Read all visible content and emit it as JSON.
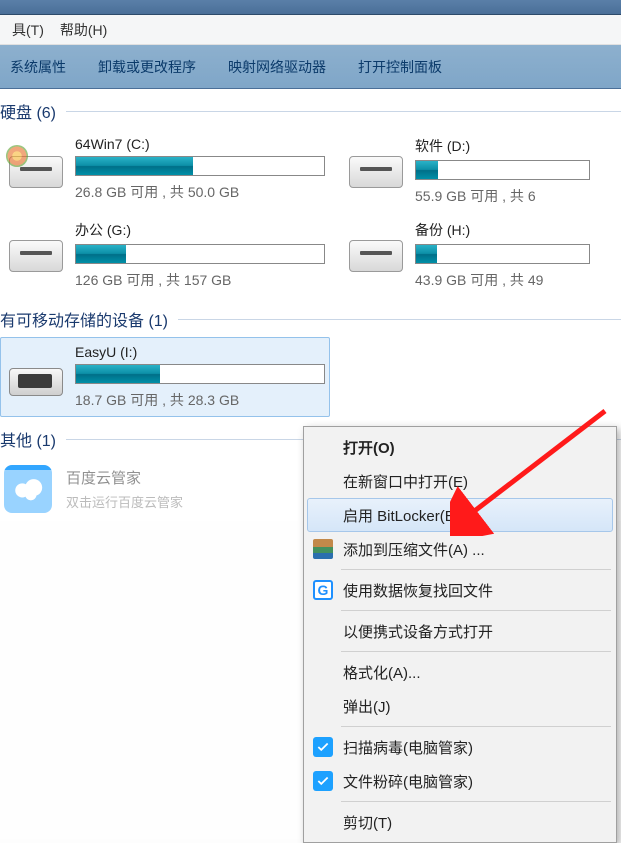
{
  "menubar": {
    "tools": "具(T)",
    "help": "帮助(H)"
  },
  "toolbar": {
    "sys_props": "系统属性",
    "uninstall": "卸载或更改程序",
    "map_drive": "映射网络驱动器",
    "ctrl_panel": "打开控制面板"
  },
  "sections": {
    "hdd": "硬盘 (6)",
    "removable": "有可移动存储的设备 (1)",
    "other": "其他 (1)"
  },
  "drives": {
    "c": {
      "name": "64Win7  (C:)",
      "stats": "26.8 GB 可用 , 共 50.0 GB",
      "pct": 47
    },
    "d": {
      "name": "软件 (D:)",
      "stats": "55.9 GB 可用 , 共 6",
      "pct": 13
    },
    "g": {
      "name": "办公 (G:)",
      "stats": "126 GB 可用 , 共 157 GB",
      "pct": 20
    },
    "h": {
      "name": "备份 (H:)",
      "stats": "43.9 GB 可用 , 共 49",
      "pct": 12
    },
    "i": {
      "name": "EasyU (I:)",
      "stats": "18.7 GB 可用 , 共 28.3 GB",
      "pct": 34
    }
  },
  "other": {
    "title": "百度云管家",
    "sub": "双击运行百度云管家"
  },
  "ctx": {
    "open": "打开(O)",
    "new_window": "在新窗口中打开(E)",
    "bitlocker": "启用 BitLocker(B)...",
    "add_archive": "添加到压缩文件(A) ...",
    "data_recovery": "使用数据恢复找回文件",
    "portable_open": "以便携式设备方式打开",
    "format": "格式化(A)...",
    "eject": "弹出(J)",
    "scan_virus": "扫描病毒(电脑管家)",
    "shred": "文件粉碎(电脑管家)",
    "cut": "剪切(T)"
  }
}
